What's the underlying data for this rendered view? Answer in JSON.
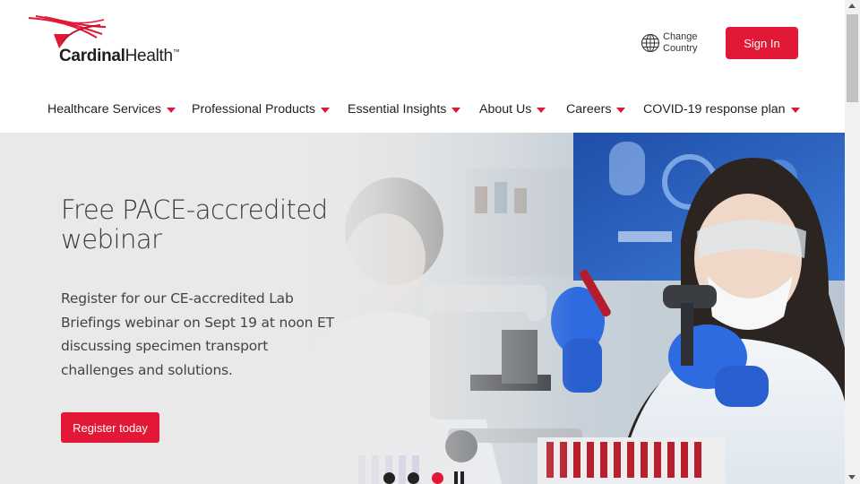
{
  "brand": {
    "name_bold": "Cardinal",
    "name_regular": "Health",
    "trademark": "™",
    "accent_color": "#e31837"
  },
  "header": {
    "change_country": "Change Country",
    "globe_icon": "globe-icon",
    "sign_in": "Sign In"
  },
  "nav": {
    "items": [
      {
        "label": "Healthcare Services"
      },
      {
        "label": "Professional Products"
      },
      {
        "label": "Essential Insights"
      },
      {
        "label": "About Us"
      },
      {
        "label": "Careers"
      },
      {
        "label": "COVID-19 response plan"
      }
    ],
    "caret_icon": "caret-down-icon"
  },
  "hero": {
    "title": "Free PACE-accredited webinar",
    "description": "Register for our CE-accredited Lab Briefings webinar on Sept 19 at noon ET discussing specimen transport challenges and solutions.",
    "cta": "Register today",
    "image_subject": "lab scientists with microscope and test tubes",
    "carousel": {
      "slide_count": 3,
      "active_slide": 3,
      "pause_icon": "pause-icon"
    }
  }
}
